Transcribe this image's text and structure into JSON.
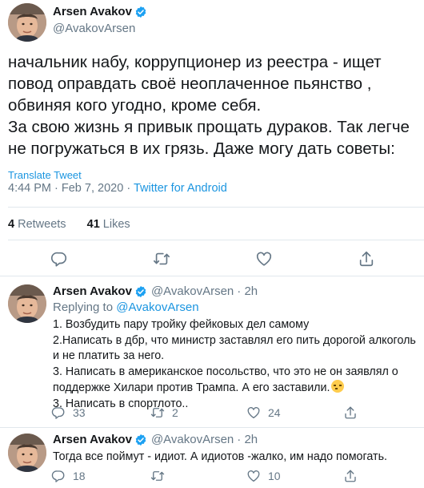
{
  "main_tweet": {
    "author_name": "Arsen Avakov",
    "handle": "@AvakovArsen",
    "text_lines": [
      "начальник набу, коррупционер из реестра - ищет",
      "повод оправдать своё неоплаченное пьянство ,",
      "обвиняя кого угодно, кроме себя.",
      "За свою жизнь я привык прощать дураков. Так легче",
      "не погружаться в их грязь. Даже могу дать советы:"
    ],
    "translate_label": "Translate Tweet",
    "time": "4:44 PM",
    "date": "Feb 7, 2020",
    "source": "Twitter for Android",
    "retweets_count": "4",
    "retweets_label": "Retweets",
    "likes_count": "41",
    "likes_label": "Likes"
  },
  "replies": [
    {
      "author_name": "Arsen Avakov",
      "handle": "@AvakovArsen",
      "time": "· 2h",
      "replying_prefix": "Replying to",
      "replying_to": "@AvakovArsen",
      "lines": [
        "1. Возбудить пару тройку фейковых дел  самому",
        "2.Написать в дбр, что министр заставлял его пить дорогой алкоголь",
        "и не платить за него.",
        "3. Написать в американское посольство, что это не он заявлял о",
        "поддержке Хилари против Трампа.  А его заставили.",
        "3. Написать в спортлото.."
      ],
      "replies": "33",
      "retweets": "2",
      "likes": "24"
    },
    {
      "author_name": "Arsen Avakov",
      "handle": "@AvakovArsen",
      "time": "· 2h",
      "lines": [
        "Тогда все поймут - идиот. А идиотов -жалко, им надо помогать."
      ],
      "replies": "18",
      "retweets": "",
      "likes": "10"
    }
  ],
  "colors": {
    "accent": "#1b95e0",
    "secondary_text": "#657786",
    "divider": "#e1e8ed",
    "verified": "#1da1f2"
  },
  "icons": [
    "verified-badge-icon",
    "reply-icon",
    "retweet-icon",
    "like-icon",
    "share-icon"
  ]
}
